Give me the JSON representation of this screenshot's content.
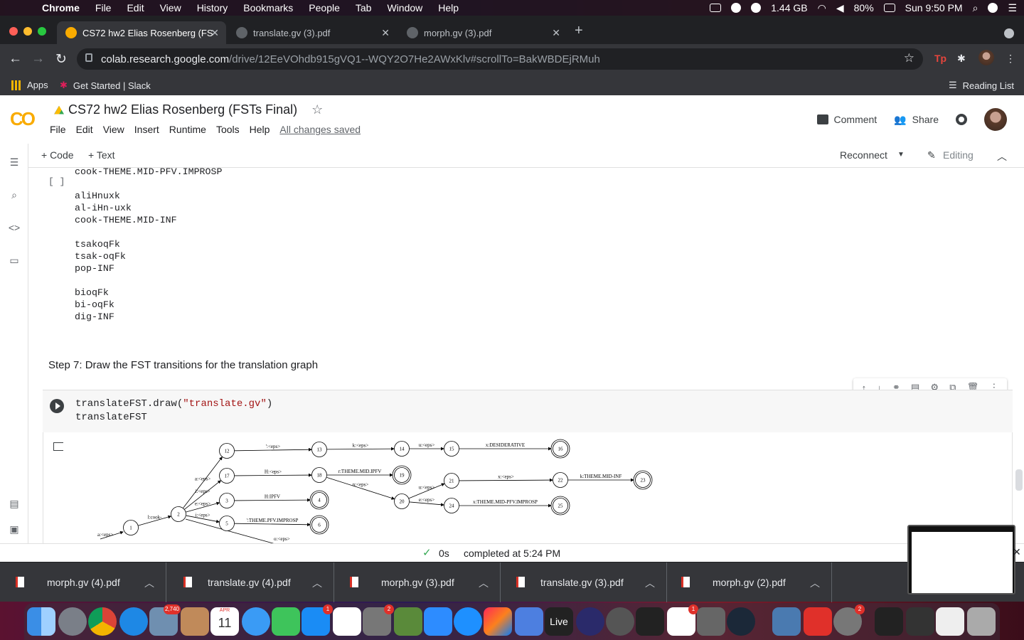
{
  "menubar": {
    "app": "Chrome",
    "items": [
      "File",
      "Edit",
      "View",
      "History",
      "Bookmarks",
      "People",
      "Tab",
      "Window",
      "Help"
    ],
    "memory": "1.44 GB",
    "battery": "80%",
    "clock": "Sun 9:50 PM"
  },
  "tabs": [
    {
      "title": "CS72 hw2 Elias Rosenberg (FS",
      "active": true
    },
    {
      "title": "translate.gv (3).pdf",
      "active": false
    },
    {
      "title": "morph.gv (3).pdf",
      "active": false
    }
  ],
  "address": {
    "host": "colab.research.google.com",
    "path": "/drive/12EeVOhdb915gVQ1--WQY2O7He2AWxKlv#scrollTo=BakWBDEjRMuh"
  },
  "bookmarks": {
    "apps": "Apps",
    "slack": "Get Started | Slack",
    "reading_list": "Reading List"
  },
  "colab": {
    "doc_title": "CS72 hw2 Elias Rosenberg (FSTs Final)",
    "menus": [
      "File",
      "Edit",
      "View",
      "Insert",
      "Runtime",
      "Tools",
      "Help"
    ],
    "saved": "All changes saved",
    "comment": "Comment",
    "share": "Share",
    "add_code": "+ Code",
    "add_text": "+ Text",
    "reconnect": "Reconnect",
    "editing": "Editing"
  },
  "output_lines": "cook-THEME.MID-PFV.IMPROSP\n\naliHnuxk\nal-iHn-uxk\ncook-THEME.MID-INF\n\ntsakoqFk\ntsak-oqFk\npop-INF\n\nbioqFk\nbi-oqFk\ndig-INF",
  "empty_cell_bracket": "[ ]",
  "step7": "Step 7: Draw the FST transitions for the translation graph",
  "code": {
    "line1_fn": "translateFST.draw(",
    "line1_arg": "\"translate.gv\"",
    "line1_end": ")",
    "line2": "translateFST"
  },
  "graph": {
    "nodes": [
      "1",
      "2",
      "3",
      "4",
      "5",
      "6",
      "12",
      "13",
      "14",
      "15",
      "16",
      "17",
      "18",
      "19",
      "20",
      "21",
      "22",
      "23",
      "24",
      "25"
    ],
    "edge_labels": {
      "e0_1": "a:<eps>",
      "e1_2": "l:cook-",
      "e2_12": "a:<eps>",
      "e2_17": "i:<eps>",
      "e2_3": "e:<eps>",
      "e2_5": "i:<eps>",
      "e12_13": "':<eps>",
      "e13_14": "k:<eps>",
      "e14_15": "u:<eps>",
      "e15_16": "x:DESIDERATIVE",
      "e17_18": "H:<eps>",
      "e18_19": "r:THEME.MID.IPFV",
      "e18_20": "n:<eps>",
      "e20_21": "u:<eps>",
      "e21_22": "x:<eps>",
      "e22_23": "k:THEME.MID-INF",
      "e20_24": "e:<eps>",
      "e24_25": "x:THEME.MID-PFV.IMPROSP",
      "e3_4": "H:IPFV",
      "e5_6": "':THEME.PFV.IMPROSP",
      "e2_o": "o:<eps>"
    }
  },
  "status": {
    "time": "0s",
    "text": "completed at 5:24 PM"
  },
  "downloads": [
    "morph.gv (4).pdf",
    "translate.gv (4).pdf",
    "morph.gv (3).pdf",
    "translate.gv (3).pdf",
    "morph.gv (2).pdf"
  ],
  "dock_badges": {
    "mail": "2,740",
    "calendar_month": "APR",
    "calendar_day": "11",
    "appstore": "1",
    "prefs": "2",
    "slack": "1",
    "adobe": "2",
    "live": "Live"
  }
}
